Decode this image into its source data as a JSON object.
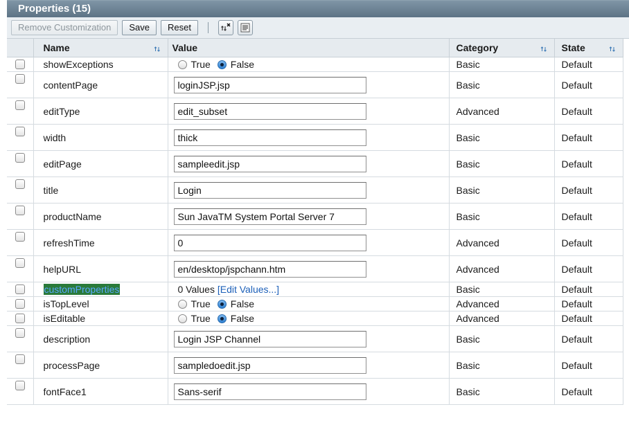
{
  "panel": {
    "title": "Properties (15)"
  },
  "toolbar": {
    "remove_label": "Remove Customization",
    "save_label": "Save",
    "reset_label": "Reset"
  },
  "columns": {
    "name": "Name",
    "value": "Value",
    "category": "Category",
    "state": "State"
  },
  "radio": {
    "true_label": "True",
    "false_label": "False"
  },
  "rows": [
    {
      "name": "showExceptions",
      "type": "radio",
      "value": "False",
      "category": "Basic",
      "state": "Default"
    },
    {
      "name": "contentPage",
      "type": "text",
      "value": "loginJSP.jsp",
      "category": "Basic",
      "state": "Default"
    },
    {
      "name": "editType",
      "type": "text",
      "value": "edit_subset",
      "category": "Advanced",
      "state": "Default"
    },
    {
      "name": "width",
      "type": "text",
      "value": "thick",
      "category": "Basic",
      "state": "Default"
    },
    {
      "name": "editPage",
      "type": "text",
      "value": "sampleedit.jsp",
      "category": "Basic",
      "state": "Default"
    },
    {
      "name": "title",
      "type": "text",
      "value": "Login",
      "category": "Basic",
      "state": "Default"
    },
    {
      "name": "productName",
      "type": "text",
      "value": "Sun JavaTM System Portal Server 7",
      "category": "Basic",
      "state": "Default"
    },
    {
      "name": "refreshTime",
      "type": "text",
      "value": "0",
      "category": "Advanced",
      "state": "Default"
    },
    {
      "name": "helpURL",
      "type": "text",
      "value": "en/desktop/jspchann.htm",
      "category": "Advanced",
      "state": "Default"
    },
    {
      "name": "customProperties",
      "type": "link",
      "value": "0 Values",
      "link": "[Edit Values...]",
      "category": "Basic",
      "state": "Default"
    },
    {
      "name": "isTopLevel",
      "type": "radio",
      "value": "False",
      "category": "Advanced",
      "state": "Default"
    },
    {
      "name": "isEditable",
      "type": "radio",
      "value": "False",
      "category": "Advanced",
      "state": "Default"
    },
    {
      "name": "description",
      "type": "text",
      "value": "Login JSP Channel",
      "category": "Basic",
      "state": "Default"
    },
    {
      "name": "processPage",
      "type": "text",
      "value": "sampledoedit.jsp",
      "category": "Basic",
      "state": "Default"
    },
    {
      "name": "fontFace1",
      "type": "text",
      "value": "Sans-serif",
      "category": "Basic",
      "state": "Default"
    }
  ]
}
